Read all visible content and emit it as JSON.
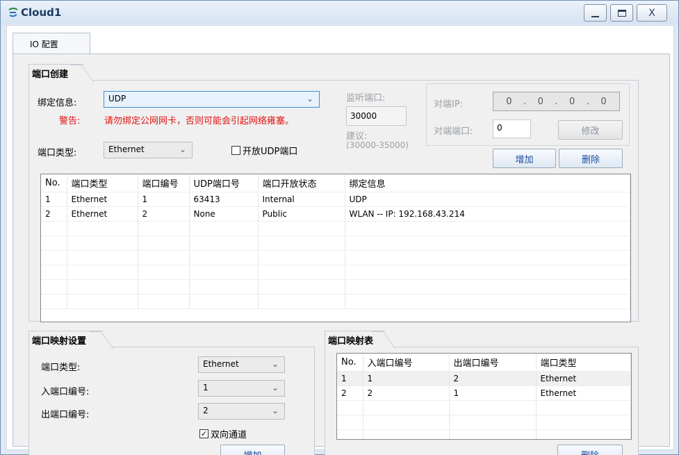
{
  "window": {
    "title": "Cloud1",
    "close_glyph": "X",
    "icon": "cloud-app-icon"
  },
  "tabs": [
    {
      "label": "IO 配置"
    }
  ],
  "port_create": {
    "heading": "端口创建",
    "bind_label": "绑定信息:",
    "bind_value": "UDP",
    "warning_label": "警告:",
    "warning_text": "请勿绑定公网网卡，否则可能会引起网络雍塞。",
    "port_type_label": "端口类型:",
    "port_type_value": "Ethernet",
    "open_udp_label": "开放UDP端口",
    "listen_port_label": "监听端口:",
    "listen_port_value": "30000",
    "suggest_label": "建议:",
    "suggest_range": "(30000-35000)",
    "peer_ip_label": "对端IP:",
    "peer_ip": [
      "0",
      ".",
      "0",
      ".",
      "0",
      ".",
      "0"
    ],
    "peer_port_label": "对端端口:",
    "peer_port_value": "0",
    "modify_label": "修改",
    "add_label": "增加",
    "delete_label": "删除",
    "table": {
      "columns": [
        "No.",
        "端口类型",
        "端口编号",
        "UDP端口号",
        "端口开放状态",
        "绑定信息"
      ],
      "rows": [
        [
          "1",
          "Ethernet",
          "1",
          "63413",
          "Internal",
          "UDP"
        ],
        [
          "2",
          "Ethernet",
          "2",
          "None",
          "Public",
          "WLAN -- IP: 192.168.43.214"
        ]
      ]
    }
  },
  "port_map_settings": {
    "heading": "端口映射设置",
    "port_type_label": "端口类型:",
    "port_type_value": "Ethernet",
    "in_port_label": "入端口编号:",
    "in_port_value": "1",
    "out_port_label": "出端口编号:",
    "out_port_value": "2",
    "bidirectional_label": "双向通道",
    "bidirectional_checked": true,
    "add_label": "增加"
  },
  "port_map_table": {
    "heading": "端口映射表",
    "columns": [
      "No.",
      "入端口编号",
      "出端口编号",
      "端口类型"
    ],
    "rows": [
      [
        "1",
        "1",
        "2",
        "Ethernet"
      ],
      [
        "2",
        "2",
        "1",
        "Ethernet"
      ]
    ],
    "delete_label": "删除"
  }
}
